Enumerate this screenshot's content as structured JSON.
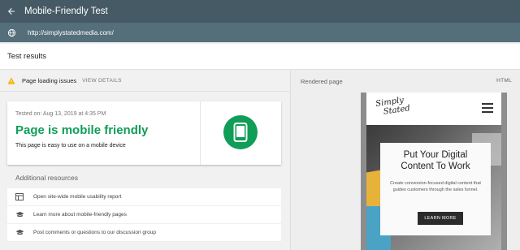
{
  "app": {
    "title": "Mobile-Friendly Test"
  },
  "url_bar": {
    "url": "http://simplystatedmedia.com/"
  },
  "results": {
    "title": "Test results"
  },
  "issues": {
    "label": "Page loading issues",
    "action": "VIEW DETAILS"
  },
  "result_card": {
    "tested_on": "Tested on: Aug 13, 2019 at 4:35 PM",
    "title": "Page is mobile friendly",
    "description": "This page is easy to use on a mobile device"
  },
  "resources": {
    "title": "Additional resources",
    "items": [
      {
        "label": "Open site-wide mobile usability report",
        "icon": "report-icon"
      },
      {
        "label": "Learn more about mobile-friendly pages",
        "icon": "school-icon"
      },
      {
        "label": "Post comments or questions to our discussion group",
        "icon": "school-icon"
      }
    ]
  },
  "rendered": {
    "label": "Rendered page",
    "html_tab": "HTML",
    "site": {
      "logo_line1": "Simply",
      "logo_line2": "Stated",
      "hero_title_line1": "Put Your Digital",
      "hero_title_line2": "Content To Work",
      "hero_sub": "Create conversion-focused digital content that guides customers through the sales funnel.",
      "cta": "LEARN MORE"
    }
  },
  "colors": {
    "topbar": "#455a64",
    "urlbar": "#546e7a",
    "success": "#0f9d58",
    "warning": "#f4b400"
  }
}
